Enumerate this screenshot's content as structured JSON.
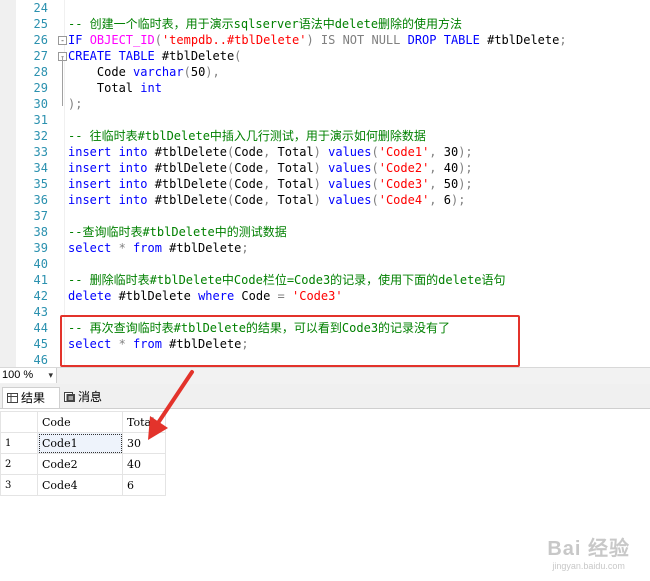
{
  "editor": {
    "lines": [
      {
        "num": "24",
        "segs": []
      },
      {
        "num": "25",
        "segs": [
          {
            "t": "-- 创建一个临时表，用于演示sqlserver语法中delete删除的使用方法",
            "c": "c-comment"
          }
        ]
      },
      {
        "num": "26",
        "fold": "-",
        "segs": [
          {
            "t": "IF ",
            "c": "c-kw"
          },
          {
            "t": "OBJECT_ID",
            "c": "c-fn"
          },
          {
            "t": "(",
            "c": "c-gray"
          },
          {
            "t": "'tempdb..#tblDelete'",
            "c": "c-str"
          },
          {
            "t": ") ",
            "c": "c-gray"
          },
          {
            "t": "IS NOT NULL ",
            "c": "c-gray"
          },
          {
            "t": "DROP TABLE ",
            "c": "c-kw"
          },
          {
            "t": "#tblDelete",
            "c": "c-txt"
          },
          {
            "t": ";",
            "c": "c-gray"
          }
        ]
      },
      {
        "num": "27",
        "fold": "-",
        "segs": [
          {
            "t": "CREATE TABLE ",
            "c": "c-kw"
          },
          {
            "t": "#tblDelete",
            "c": "c-txt"
          },
          {
            "t": "(",
            "c": "c-gray"
          }
        ]
      },
      {
        "num": "28",
        "segs": [
          {
            "t": "    Code ",
            "c": "c-txt"
          },
          {
            "t": "varchar",
            "c": "c-kw"
          },
          {
            "t": "(",
            "c": "c-gray"
          },
          {
            "t": "50",
            "c": "c-txt"
          },
          {
            "t": "),",
            "c": "c-gray"
          }
        ]
      },
      {
        "num": "29",
        "segs": [
          {
            "t": "    Total ",
            "c": "c-txt"
          },
          {
            "t": "int",
            "c": "c-kw"
          }
        ]
      },
      {
        "num": "30",
        "segs": [
          {
            "t": ");",
            "c": "c-gray"
          }
        ]
      },
      {
        "num": "31",
        "segs": []
      },
      {
        "num": "32",
        "segs": [
          {
            "t": "-- 往临时表#tblDelete中插入几行测试，用于演示如何删除数据",
            "c": "c-comment"
          }
        ]
      },
      {
        "num": "33",
        "segs": [
          {
            "t": "insert into ",
            "c": "c-kw"
          },
          {
            "t": "#tblDelete",
            "c": "c-txt"
          },
          {
            "t": "(",
            "c": "c-gray"
          },
          {
            "t": "Code",
            "c": "c-txt"
          },
          {
            "t": ", ",
            "c": "c-gray"
          },
          {
            "t": "Total",
            "c": "c-txt"
          },
          {
            "t": ") ",
            "c": "c-gray"
          },
          {
            "t": "values",
            "c": "c-kw"
          },
          {
            "t": "(",
            "c": "c-gray"
          },
          {
            "t": "'Code1'",
            "c": "c-str"
          },
          {
            "t": ", ",
            "c": "c-gray"
          },
          {
            "t": "30",
            "c": "c-txt"
          },
          {
            "t": ");",
            "c": "c-gray"
          }
        ]
      },
      {
        "num": "34",
        "segs": [
          {
            "t": "insert into ",
            "c": "c-kw"
          },
          {
            "t": "#tblDelete",
            "c": "c-txt"
          },
          {
            "t": "(",
            "c": "c-gray"
          },
          {
            "t": "Code",
            "c": "c-txt"
          },
          {
            "t": ", ",
            "c": "c-gray"
          },
          {
            "t": "Total",
            "c": "c-txt"
          },
          {
            "t": ") ",
            "c": "c-gray"
          },
          {
            "t": "values",
            "c": "c-kw"
          },
          {
            "t": "(",
            "c": "c-gray"
          },
          {
            "t": "'Code2'",
            "c": "c-str"
          },
          {
            "t": ", ",
            "c": "c-gray"
          },
          {
            "t": "40",
            "c": "c-txt"
          },
          {
            "t": ");",
            "c": "c-gray"
          }
        ]
      },
      {
        "num": "35",
        "segs": [
          {
            "t": "insert into ",
            "c": "c-kw"
          },
          {
            "t": "#tblDelete",
            "c": "c-txt"
          },
          {
            "t": "(",
            "c": "c-gray"
          },
          {
            "t": "Code",
            "c": "c-txt"
          },
          {
            "t": ", ",
            "c": "c-gray"
          },
          {
            "t": "Total",
            "c": "c-txt"
          },
          {
            "t": ") ",
            "c": "c-gray"
          },
          {
            "t": "values",
            "c": "c-kw"
          },
          {
            "t": "(",
            "c": "c-gray"
          },
          {
            "t": "'Code3'",
            "c": "c-str"
          },
          {
            "t": ", ",
            "c": "c-gray"
          },
          {
            "t": "50",
            "c": "c-txt"
          },
          {
            "t": ");",
            "c": "c-gray"
          }
        ]
      },
      {
        "num": "36",
        "segs": [
          {
            "t": "insert into ",
            "c": "c-kw"
          },
          {
            "t": "#tblDelete",
            "c": "c-txt"
          },
          {
            "t": "(",
            "c": "c-gray"
          },
          {
            "t": "Code",
            "c": "c-txt"
          },
          {
            "t": ", ",
            "c": "c-gray"
          },
          {
            "t": "Total",
            "c": "c-txt"
          },
          {
            "t": ") ",
            "c": "c-gray"
          },
          {
            "t": "values",
            "c": "c-kw"
          },
          {
            "t": "(",
            "c": "c-gray"
          },
          {
            "t": "'Code4'",
            "c": "c-str"
          },
          {
            "t": ", ",
            "c": "c-gray"
          },
          {
            "t": "6",
            "c": "c-txt"
          },
          {
            "t": ");",
            "c": "c-gray"
          }
        ]
      },
      {
        "num": "37",
        "segs": []
      },
      {
        "num": "38",
        "segs": [
          {
            "t": "--查询临时表#tblDelete中的测试数据",
            "c": "c-comment"
          }
        ]
      },
      {
        "num": "39",
        "segs": [
          {
            "t": "select ",
            "c": "c-kw"
          },
          {
            "t": "* ",
            "c": "c-gray"
          },
          {
            "t": "from ",
            "c": "c-kw"
          },
          {
            "t": "#tblDelete",
            "c": "c-txt"
          },
          {
            "t": ";",
            "c": "c-gray"
          }
        ]
      },
      {
        "num": "40",
        "segs": []
      },
      {
        "num": "41",
        "segs": [
          {
            "t": "-- 删除临时表#tblDelete中Code栏位=Code3的记录，使用下面的delete语句",
            "c": "c-comment"
          }
        ]
      },
      {
        "num": "42",
        "segs": [
          {
            "t": "delete ",
            "c": "c-kw"
          },
          {
            "t": "#tblDelete ",
            "c": "c-txt"
          },
          {
            "t": "where ",
            "c": "c-kw"
          },
          {
            "t": "Code ",
            "c": "c-txt"
          },
          {
            "t": "= ",
            "c": "c-gray"
          },
          {
            "t": "'Code3'",
            "c": "c-str"
          }
        ]
      },
      {
        "num": "43",
        "segs": []
      },
      {
        "num": "44",
        "segs": [
          {
            "t": "-- 再次查询临时表#tblDelete的结果，可以看到Code3的记录没有了",
            "c": "c-comment"
          }
        ]
      },
      {
        "num": "45",
        "segs": [
          {
            "t": "select ",
            "c": "c-kw"
          },
          {
            "t": "* ",
            "c": "c-gray"
          },
          {
            "t": "from ",
            "c": "c-kw"
          },
          {
            "t": "#tblDelete",
            "c": "c-txt"
          },
          {
            "t": ";",
            "c": "c-gray"
          }
        ]
      },
      {
        "num": "46",
        "segs": []
      }
    ]
  },
  "zoom": {
    "value": "100 %"
  },
  "tabs": {
    "results": "结果",
    "messages": "消息"
  },
  "grid": {
    "headers": [
      "Code",
      "Total"
    ],
    "rows": [
      {
        "num": "1",
        "code": "Code1",
        "total": "30"
      },
      {
        "num": "2",
        "code": "Code2",
        "total": "40"
      },
      {
        "num": "3",
        "code": "Code4",
        "total": "6"
      }
    ]
  },
  "colors": {
    "highlight": "#e3332b",
    "comment": "#008000",
    "keyword": "#0000ff",
    "string": "#ff0000"
  },
  "watermark": {
    "main": "Bai 经验",
    "sub": "jingyan.baidu.com"
  }
}
